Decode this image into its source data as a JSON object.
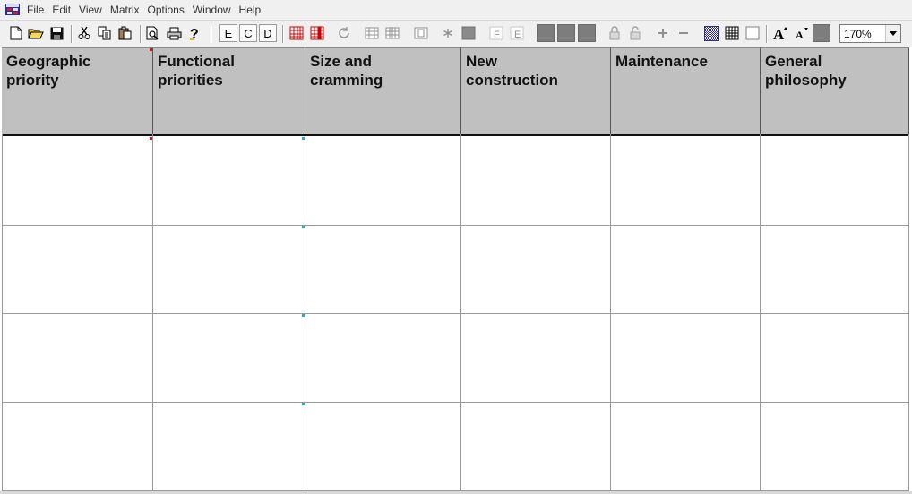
{
  "menu": [
    "File",
    "Edit",
    "View",
    "Matrix",
    "Options",
    "Window",
    "Help"
  ],
  "toolbar": {
    "letters": [
      "E",
      "C",
      "D"
    ],
    "zoom": "170%"
  },
  "matrix": {
    "columns": [
      "Geographic\npriority",
      "Functional\npriorities",
      "Size and\ncramming",
      "New\nconstruction",
      "Maintenance",
      "General\nphilosophy"
    ],
    "row_count": 4,
    "marker_colors": {
      "selection": "#e01010",
      "cyan": "#20b0c0"
    }
  }
}
